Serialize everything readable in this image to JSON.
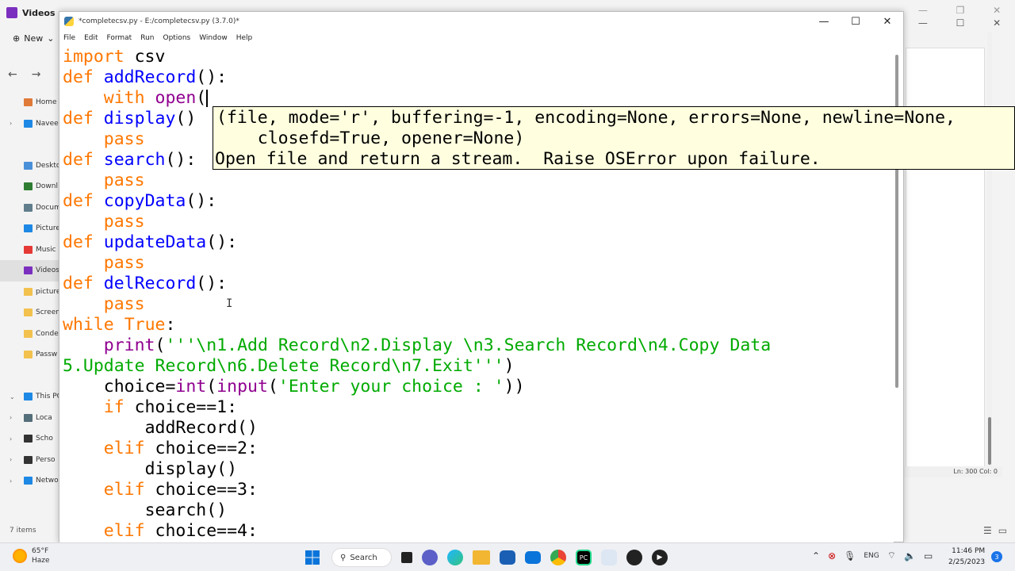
{
  "explorer": {
    "tab_title": "Videos",
    "new_label": "New",
    "sidebar": [
      {
        "label": "Home",
        "chev": "",
        "color": "#e07a38",
        "selected": false
      },
      {
        "label": "Navee",
        "chev": "›",
        "color": "#1e88e5",
        "selected": false
      },
      {
        "label": "",
        "chev": "",
        "color": "transparent",
        "selected": false
      },
      {
        "label": "Deskto",
        "chev": "",
        "color": "#4a90d9",
        "selected": false
      },
      {
        "label": "Downl",
        "chev": "",
        "color": "#2e7d32",
        "selected": false
      },
      {
        "label": "Docum",
        "chev": "",
        "color": "#607d8b",
        "selected": false
      },
      {
        "label": "Picture",
        "chev": "",
        "color": "#1e88e5",
        "selected": false
      },
      {
        "label": "Music",
        "chev": "",
        "color": "#e53935",
        "selected": false
      },
      {
        "label": "Videos",
        "chev": "",
        "color": "#7b2fbf",
        "selected": true
      },
      {
        "label": "picture",
        "chev": "",
        "color": "#f2c14e",
        "selected": false
      },
      {
        "label": "Screen",
        "chev": "",
        "color": "#f2c14e",
        "selected": false
      },
      {
        "label": "Conde",
        "chev": "",
        "color": "#f2c14e",
        "selected": false
      },
      {
        "label": "Passw",
        "chev": "",
        "color": "#f2c14e",
        "selected": false
      },
      {
        "label": "",
        "chev": "",
        "color": "transparent",
        "selected": false
      },
      {
        "label": "This PC",
        "chev": "⌄",
        "color": "#1e88e5",
        "selected": false
      },
      {
        "label": "Loca",
        "chev": "›",
        "color": "#546e7a",
        "selected": false
      },
      {
        "label": "Scho",
        "chev": "›",
        "color": "#333333",
        "selected": false
      },
      {
        "label": "Perso",
        "chev": "›",
        "color": "#333333",
        "selected": false
      },
      {
        "label": "Netwo",
        "chev": "›",
        "color": "#1e88e5",
        "selected": false
      }
    ],
    "item_count": "7 items"
  },
  "bg_window": {
    "status": "Ln: 300   Col: 0"
  },
  "idle": {
    "title": "*completecsv.py - E:/completecsv.py (3.7.0)*",
    "menu": [
      "File",
      "Edit",
      "Format",
      "Run",
      "Options",
      "Window",
      "Help"
    ],
    "calltip": {
      "line1": "(file, mode='r', buffering=-1, encoding=None, errors=None, newline=None,",
      "line2": "    closefd=True, opener=None)",
      "line3": "Open file and return a stream.  Raise OSError upon failure."
    },
    "code": {
      "l1_kw": "import",
      "l1_rest": " csv",
      "def": "def",
      "l2_fn": "addRecord",
      "l2_rest": "():",
      "l3_kw": "with",
      "l3_bi": "open",
      "l3_rest": "(",
      "l4_fn": "display",
      "l4_rest": "()",
      "pass": "pass",
      "l6_fn": "search",
      "l6_rest": "():",
      "l8_fn": "copyData",
      "l8_rest": "():",
      "l10_fn": "updateData",
      "l10_rest": "():",
      "l12_fn": "delRecord",
      "l12_rest": "():",
      "l14_kw": "while",
      "l14_kw2": "True",
      "l14_rest": ":",
      "l15_bi": "print",
      "l15_p": "(",
      "l15_st": "'''\\n1.Add Record\\n2.Display \\n3.Search Record\\n4.Copy Data",
      "l16_st": "5.Update Record\\n6.Delete Record\\n7.Exit'''",
      "l16_rest": ")",
      "l17_a": "choice=",
      "l17_bi": "int",
      "l17_p1": "(",
      "l17_bi2": "input",
      "l17_p2": "(",
      "l17_st": "'Enter your choice : '",
      "l17_p3": "))",
      "if": "if",
      "elif": "elif",
      "l18_rest": " choice==1:",
      "l19": "addRecord()",
      "l20_rest": " choice==2:",
      "l21": "display()",
      "l22_rest": " choice==3:",
      "l23": "search()",
      "l24_rest": " choice==4:"
    }
  },
  "taskbar": {
    "temp": "65°F",
    "condition": "Haze",
    "search": "Search",
    "lang": "ENG",
    "time": "11:46 PM",
    "date": "2/25/2023",
    "notifications": "3"
  }
}
